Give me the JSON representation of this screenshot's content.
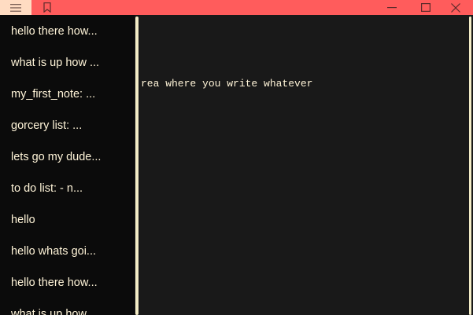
{
  "titlebar": {
    "accent_color": "#ff5c5c",
    "menu_button_color": "#ffdcc2",
    "icons": {
      "menu": "hamburger-icon",
      "bookmark": "bookmark-icon",
      "minimize": "minimize-icon",
      "maximize": "maximize-icon",
      "close": "close-icon"
    }
  },
  "sidebar": {
    "background": "#0b0b0b",
    "text_color": "#fff4d8",
    "notes": [
      "hello there how...",
      "what is up how ...",
      "my_first_note: ...",
      "gorcery list: ...",
      "lets go my dude...",
      "to do list: - n...",
      "hello",
      "hello whats goi...",
      "hello there how...",
      "what is up how ..."
    ]
  },
  "editor": {
    "background": "#191919",
    "content": "rea where you write whatever"
  }
}
